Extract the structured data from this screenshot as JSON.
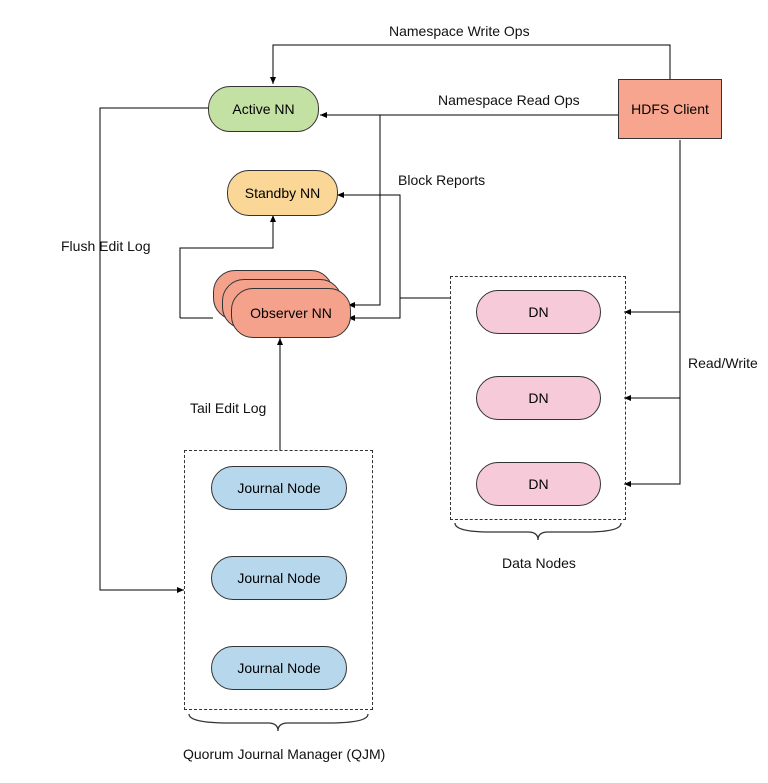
{
  "nodes": {
    "active_nn": "Active NN",
    "standby_nn": "Standby NN",
    "observer_nn": "Observer NN",
    "hdfs_client": "HDFS Client",
    "dn": "DN",
    "journal_node": "Journal Node"
  },
  "labels": {
    "namespace_write_ops": "Namespace Write Ops",
    "namespace_read_ops": "Namespace Read Ops",
    "block_reports": "Block Reports",
    "flush_edit_log": "Flush Edit Log",
    "tail_edit_log": "Tail Edit Log",
    "read_write": "Read/Write",
    "data_nodes": "Data Nodes",
    "qjm": "Quorum Journal Manager (QJM)"
  },
  "colors": {
    "green": "#c4e1a4",
    "orange": "#fad796",
    "salmon_deep": "#f4a28c",
    "salmon": "#f7b29f",
    "pink": "#f6cad8",
    "blue": "#b7d7ed"
  }
}
